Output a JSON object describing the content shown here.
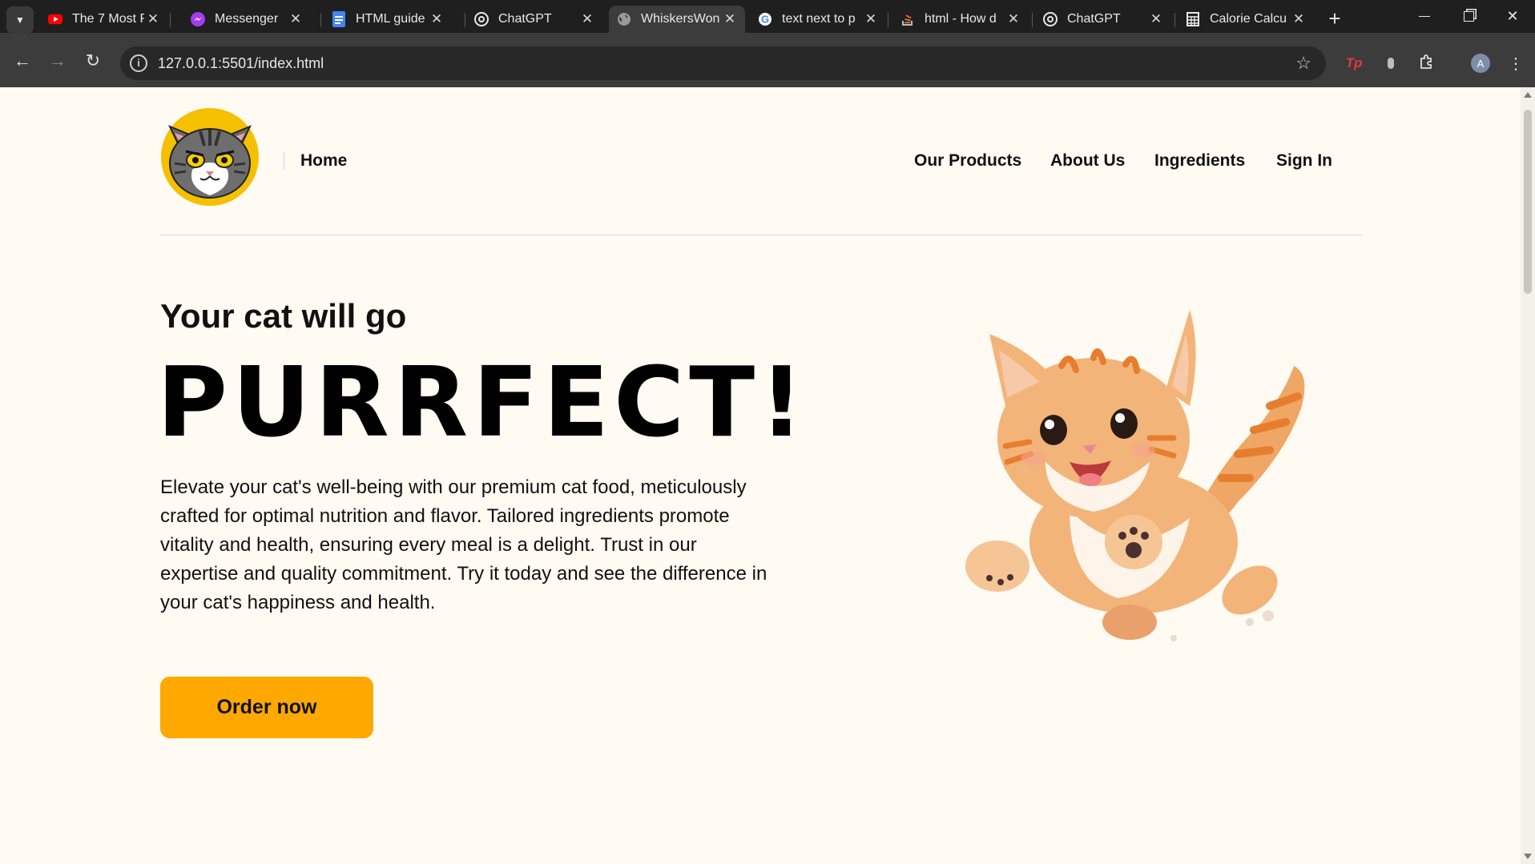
{
  "browser": {
    "tabs": [
      {
        "title": "The 7 Most P",
        "favicon": "youtube-icon",
        "active": false
      },
      {
        "title": "Messenger",
        "favicon": "messenger-icon",
        "active": false
      },
      {
        "title": "HTML guide -",
        "favicon": "google-docs-icon",
        "active": false
      },
      {
        "title": "ChatGPT",
        "favicon": "chatgpt-icon",
        "active": false
      },
      {
        "title": "WhiskersWon",
        "favicon": "globe-icon",
        "active": true
      },
      {
        "title": "text next to p",
        "favicon": "google-icon",
        "active": false
      },
      {
        "title": "html - How d",
        "favicon": "stackoverflow-icon",
        "active": false
      },
      {
        "title": "ChatGPT",
        "favicon": "chatgpt-icon",
        "active": false
      },
      {
        "title": "Calorie Calcu",
        "favicon": "calculator-icon",
        "active": false
      }
    ],
    "url": "127.0.0.1:5501/index.html",
    "profile_initial": "A",
    "extension_badge": "Tp"
  },
  "header": {
    "logo_alt": "cat logo",
    "home_label": "Home",
    "nav": [
      "Our Products",
      "About Us",
      "Ingredients",
      "Sign In"
    ]
  },
  "hero": {
    "kicker": "Your cat will go",
    "title": "PURRFECT!",
    "description": "Elevate your cat's well-being with our premium cat food, meticulously crafted for optimal nutrition and flavor. Tailored ingredients promote vitality and health, ensuring every meal is a delight. Trust in our expertise and quality commitment. Try it today and see the difference in your cat's happiness and health.",
    "cta_label": "Order now",
    "image_alt": "jumping kitten"
  },
  "colors": {
    "page_bg": "#fffaf2",
    "accent": "#ffa800",
    "text": "#111111"
  }
}
